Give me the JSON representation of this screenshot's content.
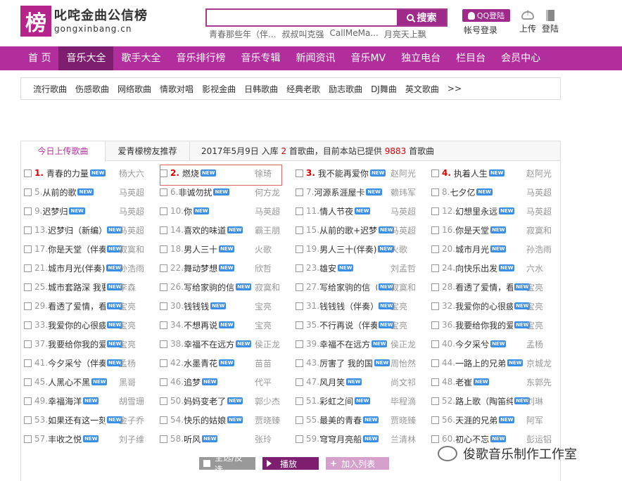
{
  "header": {
    "logo_mark": "榜",
    "logo_cn": "叱咤金曲公信榜",
    "logo_en": "gongxinbang.cn",
    "search_placeholder": "",
    "search_button": "搜索",
    "hot_keywords": [
      "青春那些年（伴...",
      "叔叔叫克强",
      "CallMeMa...",
      "月亮天上飘"
    ],
    "qq_login": "QQ登陆",
    "account_login": "帐号登录",
    "upload": "上传",
    "login": "登陆"
  },
  "nav": [
    "首 页",
    "音乐大全",
    "歌手大全",
    "音乐排行榜",
    "音乐专辑",
    "新闻资讯",
    "音乐MV",
    "独立电台",
    "栏目台",
    "会员中心"
  ],
  "nav_active_index": 1,
  "subnav": [
    "流行歌曲",
    "伤感歌曲",
    "网络歌曲",
    "情歌对唱",
    "影视金曲",
    "日韩歌曲",
    "经典老歌",
    "励志歌曲",
    "DJ舞曲",
    "英文歌曲",
    ">>"
  ],
  "tabs": [
    "今日上传歌曲",
    "爱青檬榜友推荐"
  ],
  "info": {
    "prefix": "2017年5月9日 入库 ",
    "count_today": "2",
    "middle": " 首歌曲，目前本站已提供 ",
    "count_total": "9883",
    "suffix": " 首歌曲"
  },
  "new_badge": "NEW",
  "songs": [
    {
      "n": "1.",
      "t": "青春的力量",
      "a": "杨大六"
    },
    {
      "n": "2.",
      "t": "燃烧",
      "a": "徐琦"
    },
    {
      "n": "3.",
      "t": "我不能再爱你",
      "a": "赵阿光"
    },
    {
      "n": "4.",
      "t": "执着人生",
      "a": "赵阿光"
    },
    {
      "n": "5.",
      "t": "从前的歌",
      "a": "马英超"
    },
    {
      "n": "6.",
      "t": "非诚勿扰",
      "a": "何方龙"
    },
    {
      "n": "7.",
      "t": "河源系涯屋卡",
      "a": "赖玮军"
    },
    {
      "n": "8.",
      "t": "七夕亿",
      "a": "马英超"
    },
    {
      "n": "9.",
      "t": "迟梦归",
      "a": "马英超"
    },
    {
      "n": "10.",
      "t": "你",
      "a": "马英超"
    },
    {
      "n": "11.",
      "t": "情人节夜",
      "a": "马英超"
    },
    {
      "n": "12.",
      "t": "幻想里永远",
      "a": "马英超"
    },
    {
      "n": "13.",
      "t": "迟梦归（新编）",
      "a": "马英超"
    },
    {
      "n": "14.",
      "t": "喜欢的味道",
      "a": "霸王朋"
    },
    {
      "n": "15.",
      "t": "从前的歌+迟梦归",
      "a": "马英超"
    },
    {
      "n": "16.",
      "t": "你是天堂",
      "a": "寂寞和"
    },
    {
      "n": "17.",
      "t": "你是天堂（伴奏）",
      "a": "寂寞和"
    },
    {
      "n": "18.",
      "t": "男人三十",
      "a": "火歌"
    },
    {
      "n": "19.",
      "t": "男人三十(伴奏)",
      "a": "火歌"
    },
    {
      "n": "20.",
      "t": "城市月光",
      "a": "孙浩雨"
    },
    {
      "n": "21.",
      "t": "城市月光(伴奏)",
      "a": "孙浩雨"
    },
    {
      "n": "22.",
      "t": "舞动梦想",
      "a": "欣哲"
    },
    {
      "n": "23.",
      "t": "雄安",
      "a": "刘孟哲"
    },
    {
      "n": "24.",
      "t": "向快乐出发",
      "a": "六水"
    },
    {
      "n": "25.",
      "t": "城市套路深 我要回",
      "a": "李森"
    },
    {
      "n": "26.",
      "t": "写给家驹的信",
      "a": "寂寞和"
    },
    {
      "n": "27.",
      "t": "写给家驹的信（伴",
      "a": "寂寞和"
    },
    {
      "n": "28.",
      "t": "看透了爱情，看透",
      "a": "宝亮"
    },
    {
      "n": "29.",
      "t": "看透了爱情，看透",
      "a": "宝亮"
    },
    {
      "n": "30.",
      "t": "钱钱钱",
      "a": "宝亮"
    },
    {
      "n": "31.",
      "t": "钱钱钱（伴奏）",
      "a": "宝亮"
    },
    {
      "n": "32.",
      "t": "我爱你的心很疲惫",
      "a": "宝亮"
    },
    {
      "n": "33.",
      "t": "我爱你的心很疲备",
      "a": "宝亮"
    },
    {
      "n": "34.",
      "t": "不想再说",
      "a": "宝亮"
    },
    {
      "n": "35.",
      "t": "不行再说（伴奏）",
      "a": "宝亮"
    },
    {
      "n": "36.",
      "t": "我要给你我的爱",
      "a": "宝亮"
    },
    {
      "n": "37.",
      "t": "我要给你我的爱",
      "a": "宝亮"
    },
    {
      "n": "38.",
      "t": "幸福不在远方",
      "a": "侯正龙"
    },
    {
      "n": "39.",
      "t": "幸福不在远方",
      "a": "侯正龙"
    },
    {
      "n": "40.",
      "t": "今夕采兮",
      "a": "孟杨"
    },
    {
      "n": "41.",
      "t": "今夕采兮（伴奏）",
      "a": "孟杨"
    },
    {
      "n": "42.",
      "t": "水墨青花",
      "a": "苗苗"
    },
    {
      "n": "43.",
      "t": "厉害了 我的国",
      "a": "周怡然"
    },
    {
      "n": "44.",
      "t": "一路上的兄弟",
      "a": "京城龙"
    },
    {
      "n": "45.",
      "t": "人黑心不黑",
      "a": "黑哥"
    },
    {
      "n": "46.",
      "t": "追梦",
      "a": "代平"
    },
    {
      "n": "47.",
      "t": "风月笑",
      "a": "尚文祁"
    },
    {
      "n": "48.",
      "t": "老崔",
      "a": "东郭先"
    },
    {
      "n": "49.",
      "t": "幸福海洋",
      "a": "胡雪珊"
    },
    {
      "n": "50.",
      "t": "妈妈变老了",
      "a": "郭少杰"
    },
    {
      "n": "51.",
      "t": "彩虹之间",
      "a": "毕程滴"
    },
    {
      "n": "52.",
      "t": "路上歌（陶笛纯音",
      "a": "刘琳"
    },
    {
      "n": "53.",
      "t": "如果还有这一刻",
      "a": "金子乔"
    },
    {
      "n": "54.",
      "t": "快乐的姑娘",
      "a": "贾晓臻"
    },
    {
      "n": "55.",
      "t": "最美的青春",
      "a": "贾晓臻"
    },
    {
      "n": "56.",
      "t": "天涯的兄弟",
      "a": "阿军"
    },
    {
      "n": "57.",
      "t": "丰收之悦",
      "a": "刘子维"
    },
    {
      "n": "58.",
      "t": "听风",
      "a": "张玲"
    },
    {
      "n": "59.",
      "t": "穹穹月亮船",
      "a": "兰清林"
    },
    {
      "n": "60.",
      "t": "初心不忘",
      "a": "彭运铝"
    }
  ],
  "buttons": {
    "select_all": "全选/反选",
    "play": "播放",
    "add": "加入列表"
  },
  "watermark": "俊歌音乐制作工作室",
  "colors": {
    "brand": "#b22e9d",
    "brand_dark": "#7d1e6e",
    "accent_red": "#dd0000"
  }
}
